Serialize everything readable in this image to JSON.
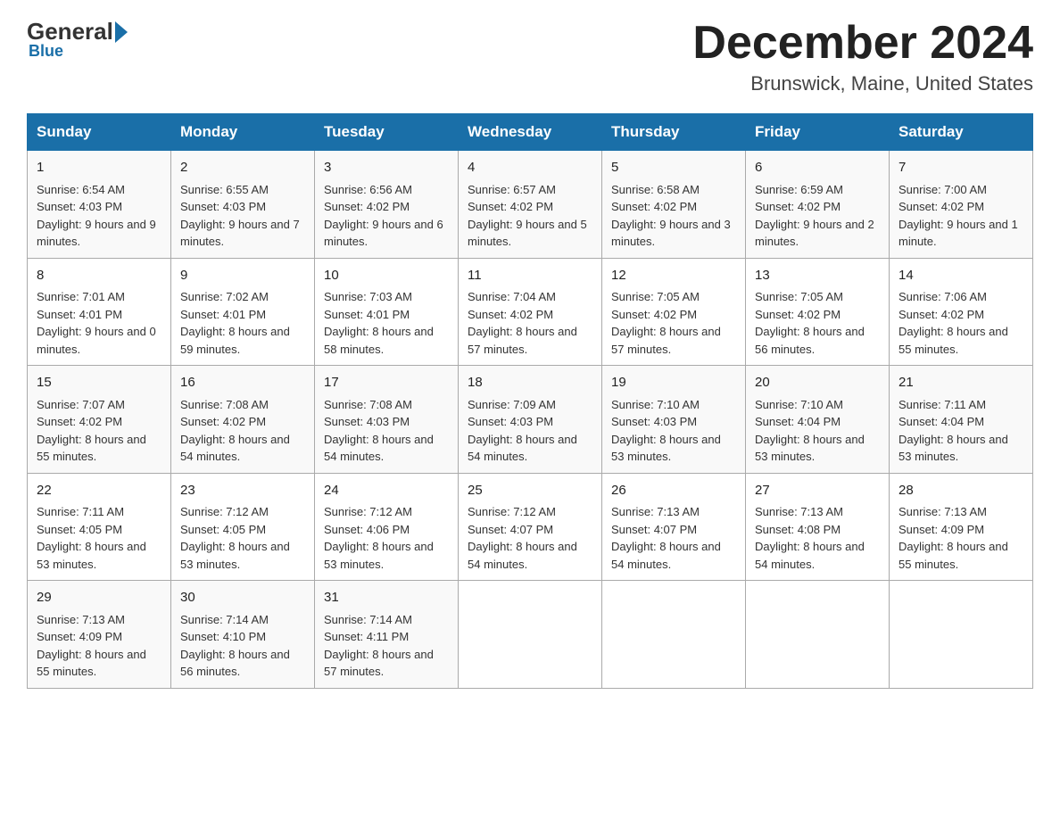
{
  "header": {
    "logo_text": "General",
    "logo_blue": "Blue",
    "month_title": "December 2024",
    "location": "Brunswick, Maine, United States"
  },
  "days_of_week": [
    "Sunday",
    "Monday",
    "Tuesday",
    "Wednesday",
    "Thursday",
    "Friday",
    "Saturday"
  ],
  "weeks": [
    [
      {
        "day": "1",
        "sunrise": "Sunrise: 6:54 AM",
        "sunset": "Sunset: 4:03 PM",
        "daylight": "Daylight: 9 hours and 9 minutes."
      },
      {
        "day": "2",
        "sunrise": "Sunrise: 6:55 AM",
        "sunset": "Sunset: 4:03 PM",
        "daylight": "Daylight: 9 hours and 7 minutes."
      },
      {
        "day": "3",
        "sunrise": "Sunrise: 6:56 AM",
        "sunset": "Sunset: 4:02 PM",
        "daylight": "Daylight: 9 hours and 6 minutes."
      },
      {
        "day": "4",
        "sunrise": "Sunrise: 6:57 AM",
        "sunset": "Sunset: 4:02 PM",
        "daylight": "Daylight: 9 hours and 5 minutes."
      },
      {
        "day": "5",
        "sunrise": "Sunrise: 6:58 AM",
        "sunset": "Sunset: 4:02 PM",
        "daylight": "Daylight: 9 hours and 3 minutes."
      },
      {
        "day": "6",
        "sunrise": "Sunrise: 6:59 AM",
        "sunset": "Sunset: 4:02 PM",
        "daylight": "Daylight: 9 hours and 2 minutes."
      },
      {
        "day": "7",
        "sunrise": "Sunrise: 7:00 AM",
        "sunset": "Sunset: 4:02 PM",
        "daylight": "Daylight: 9 hours and 1 minute."
      }
    ],
    [
      {
        "day": "8",
        "sunrise": "Sunrise: 7:01 AM",
        "sunset": "Sunset: 4:01 PM",
        "daylight": "Daylight: 9 hours and 0 minutes."
      },
      {
        "day": "9",
        "sunrise": "Sunrise: 7:02 AM",
        "sunset": "Sunset: 4:01 PM",
        "daylight": "Daylight: 8 hours and 59 minutes."
      },
      {
        "day": "10",
        "sunrise": "Sunrise: 7:03 AM",
        "sunset": "Sunset: 4:01 PM",
        "daylight": "Daylight: 8 hours and 58 minutes."
      },
      {
        "day": "11",
        "sunrise": "Sunrise: 7:04 AM",
        "sunset": "Sunset: 4:02 PM",
        "daylight": "Daylight: 8 hours and 57 minutes."
      },
      {
        "day": "12",
        "sunrise": "Sunrise: 7:05 AM",
        "sunset": "Sunset: 4:02 PM",
        "daylight": "Daylight: 8 hours and 57 minutes."
      },
      {
        "day": "13",
        "sunrise": "Sunrise: 7:05 AM",
        "sunset": "Sunset: 4:02 PM",
        "daylight": "Daylight: 8 hours and 56 minutes."
      },
      {
        "day": "14",
        "sunrise": "Sunrise: 7:06 AM",
        "sunset": "Sunset: 4:02 PM",
        "daylight": "Daylight: 8 hours and 55 minutes."
      }
    ],
    [
      {
        "day": "15",
        "sunrise": "Sunrise: 7:07 AM",
        "sunset": "Sunset: 4:02 PM",
        "daylight": "Daylight: 8 hours and 55 minutes."
      },
      {
        "day": "16",
        "sunrise": "Sunrise: 7:08 AM",
        "sunset": "Sunset: 4:02 PM",
        "daylight": "Daylight: 8 hours and 54 minutes."
      },
      {
        "day": "17",
        "sunrise": "Sunrise: 7:08 AM",
        "sunset": "Sunset: 4:03 PM",
        "daylight": "Daylight: 8 hours and 54 minutes."
      },
      {
        "day": "18",
        "sunrise": "Sunrise: 7:09 AM",
        "sunset": "Sunset: 4:03 PM",
        "daylight": "Daylight: 8 hours and 54 minutes."
      },
      {
        "day": "19",
        "sunrise": "Sunrise: 7:10 AM",
        "sunset": "Sunset: 4:03 PM",
        "daylight": "Daylight: 8 hours and 53 minutes."
      },
      {
        "day": "20",
        "sunrise": "Sunrise: 7:10 AM",
        "sunset": "Sunset: 4:04 PM",
        "daylight": "Daylight: 8 hours and 53 minutes."
      },
      {
        "day": "21",
        "sunrise": "Sunrise: 7:11 AM",
        "sunset": "Sunset: 4:04 PM",
        "daylight": "Daylight: 8 hours and 53 minutes."
      }
    ],
    [
      {
        "day": "22",
        "sunrise": "Sunrise: 7:11 AM",
        "sunset": "Sunset: 4:05 PM",
        "daylight": "Daylight: 8 hours and 53 minutes."
      },
      {
        "day": "23",
        "sunrise": "Sunrise: 7:12 AM",
        "sunset": "Sunset: 4:05 PM",
        "daylight": "Daylight: 8 hours and 53 minutes."
      },
      {
        "day": "24",
        "sunrise": "Sunrise: 7:12 AM",
        "sunset": "Sunset: 4:06 PM",
        "daylight": "Daylight: 8 hours and 53 minutes."
      },
      {
        "day": "25",
        "sunrise": "Sunrise: 7:12 AM",
        "sunset": "Sunset: 4:07 PM",
        "daylight": "Daylight: 8 hours and 54 minutes."
      },
      {
        "day": "26",
        "sunrise": "Sunrise: 7:13 AM",
        "sunset": "Sunset: 4:07 PM",
        "daylight": "Daylight: 8 hours and 54 minutes."
      },
      {
        "day": "27",
        "sunrise": "Sunrise: 7:13 AM",
        "sunset": "Sunset: 4:08 PM",
        "daylight": "Daylight: 8 hours and 54 minutes."
      },
      {
        "day": "28",
        "sunrise": "Sunrise: 7:13 AM",
        "sunset": "Sunset: 4:09 PM",
        "daylight": "Daylight: 8 hours and 55 minutes."
      }
    ],
    [
      {
        "day": "29",
        "sunrise": "Sunrise: 7:13 AM",
        "sunset": "Sunset: 4:09 PM",
        "daylight": "Daylight: 8 hours and 55 minutes."
      },
      {
        "day": "30",
        "sunrise": "Sunrise: 7:14 AM",
        "sunset": "Sunset: 4:10 PM",
        "daylight": "Daylight: 8 hours and 56 minutes."
      },
      {
        "day": "31",
        "sunrise": "Sunrise: 7:14 AM",
        "sunset": "Sunset: 4:11 PM",
        "daylight": "Daylight: 8 hours and 57 minutes."
      },
      null,
      null,
      null,
      null
    ]
  ]
}
